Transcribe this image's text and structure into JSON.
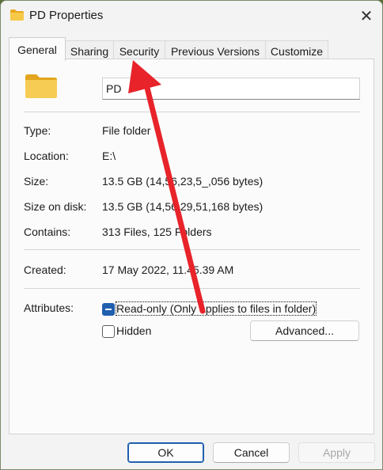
{
  "window": {
    "title": "PD Properties",
    "title_icon": "folder-icon",
    "close_icon": "close-icon",
    "close_glyph": "✕"
  },
  "tabs": [
    {
      "label": "General",
      "active": true
    },
    {
      "label": "Sharing",
      "active": false
    },
    {
      "label": "Security",
      "active": false
    },
    {
      "label": "Previous Versions",
      "active": false
    },
    {
      "label": "Customize",
      "active": false
    }
  ],
  "general": {
    "folder_icon": "folder-icon",
    "name_value": "PD",
    "type_label": "Type:",
    "type_value": "File folder",
    "location_label": "Location:",
    "location_value": "E:\\",
    "size_label": "Size:",
    "size_value": "13.5 GB (14,56,23,5_,056 bytes)",
    "size_on_disk_label": "Size on disk:",
    "size_on_disk_value": "13.5 GB (14,56,29,51,168 bytes)",
    "contains_label": "Contains:",
    "contains_value": "313 Files, 125 Folders",
    "created_label": "Created:",
    "created_value": "17 May 2022, 11.45.39 AM",
    "attributes_label": "Attributes:",
    "readonly_label": "Read-only (Only applies to files in folder)",
    "readonly_state": "indeterminate",
    "hidden_label": "Hidden",
    "hidden_state": "unchecked",
    "advanced_label": "Advanced..."
  },
  "footer": {
    "ok_label": "OK",
    "cancel_label": "Cancel",
    "apply_label": "Apply"
  },
  "colors": {
    "accent": "#1f5fae",
    "annotation_arrow": "#e8232a",
    "folder_yellow": "#f5c33b"
  }
}
